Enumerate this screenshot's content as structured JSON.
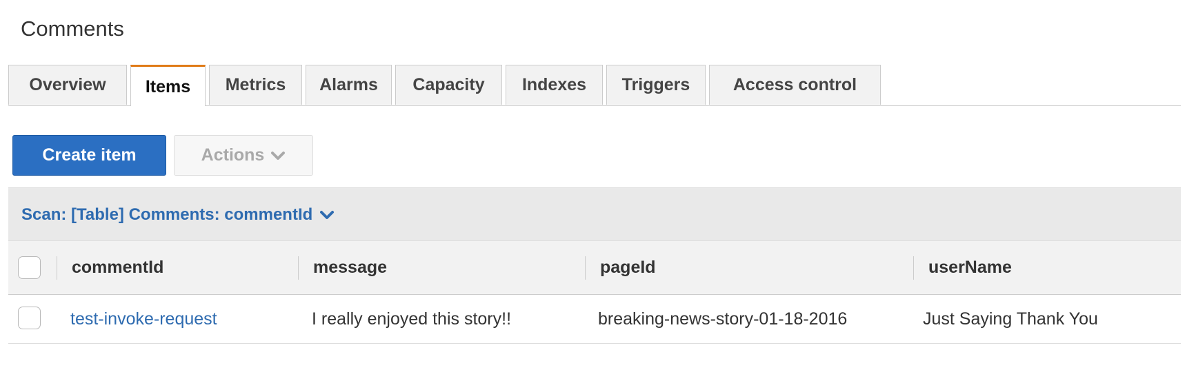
{
  "page": {
    "title": "Comments"
  },
  "tabs": [
    {
      "label": "Overview",
      "active": false
    },
    {
      "label": "Items",
      "active": true
    },
    {
      "label": "Metrics",
      "active": false
    },
    {
      "label": "Alarms",
      "active": false
    },
    {
      "label": "Capacity",
      "active": false
    },
    {
      "label": "Indexes",
      "active": false
    },
    {
      "label": "Triggers",
      "active": false
    },
    {
      "label": "Access control",
      "active": false
    }
  ],
  "toolbar": {
    "create_label": "Create item",
    "actions_label": "Actions",
    "actions_icon": "chevron-down-icon"
  },
  "scan": {
    "label": "Scan: [Table] Comments: commentId",
    "icon": "chevron-down-icon"
  },
  "table": {
    "columns": [
      "commentId",
      "message",
      "pageId",
      "userName"
    ],
    "rows": [
      {
        "commentId": "test-invoke-request",
        "message": "I really enjoyed this story!!",
        "pageId": "breaking-news-story-01-18-2016",
        "userName": "Just Saying Thank You"
      }
    ]
  },
  "colors": {
    "accent": "#e07b17",
    "primary": "#2b6fc2",
    "link": "#2e6bb0"
  }
}
